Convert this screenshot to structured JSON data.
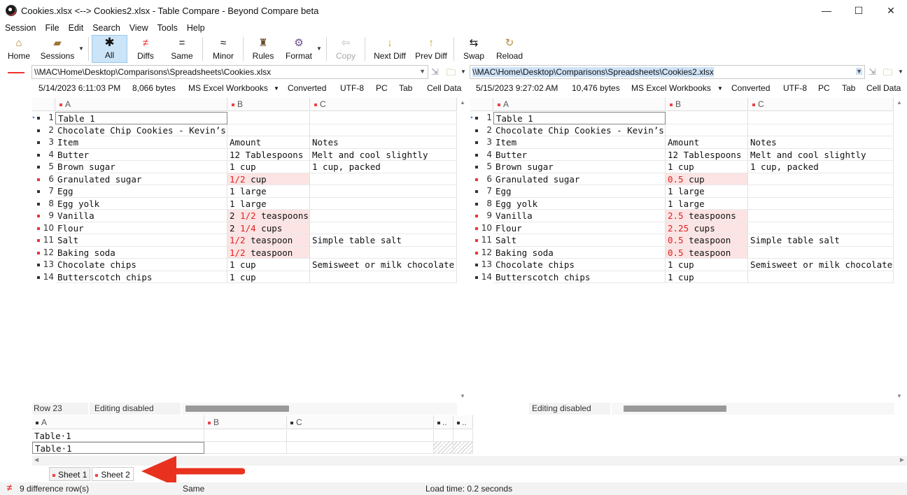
{
  "window": {
    "title": "Cookies.xlsx <--> Cookies2.xlsx - Table Compare - Beyond Compare beta",
    "minimize": "—",
    "maximize": "☐",
    "close": "✕"
  },
  "menu": [
    "Session",
    "File",
    "Edit",
    "Search",
    "View",
    "Tools",
    "Help"
  ],
  "toolbar": {
    "home": "Home",
    "sessions": "Sessions",
    "all": "All",
    "diffs": "Diffs",
    "same": "Same",
    "minor": "Minor",
    "rules": "Rules",
    "format": "Format",
    "copy": "Copy",
    "next_diff": "Next Diff",
    "prev_diff": "Prev Diff",
    "swap": "Swap",
    "reload": "Reload"
  },
  "left": {
    "path": "\\\\MAC\\Home\\Desktop\\Comparisons\\Spreadsheets\\Cookies.xlsx",
    "date": "5/14/2023 6:11:03 PM",
    "size": "8,066 bytes",
    "format": "MS Excel Workbooks",
    "converted": "Converted",
    "encoding": "UTF-8",
    "lineend": "PC",
    "delim": "Tab",
    "celldata": "Cell Data",
    "status_row": "Row 23",
    "status_edit": "Editing disabled"
  },
  "right": {
    "path": "\\\\MAC\\Home\\Desktop\\Comparisons\\Spreadsheets\\Cookies2.xlsx",
    "date": "5/15/2023 9:27:02 AM",
    "size": "10,476 bytes",
    "format": "MS Excel Workbooks",
    "converted": "Converted",
    "encoding": "UTF-8",
    "lineend": "PC",
    "delim": "Tab",
    "celldata": "Cell Data",
    "status_edit": "Editing disabled"
  },
  "columns": [
    "A",
    "B",
    "C"
  ],
  "rows_left": [
    {
      "n": "1",
      "a": "Table 1",
      "b": "",
      "c": ""
    },
    {
      "n": "2",
      "a": "Chocolate Chip Cookies - Kevin’s",
      "b": "",
      "c": ""
    },
    {
      "n": "3",
      "a": "Item",
      "b": "Amount",
      "c": "Notes"
    },
    {
      "n": "4",
      "a": "Butter",
      "b": "12 Tablespoons",
      "c": "Melt and cool slightly"
    },
    {
      "n": "5",
      "a": "Brown sugar",
      "b": "1 cup",
      "c": "1 cup, packed"
    },
    {
      "n": "6",
      "a": "Granulated sugar",
      "b_red": "1/2",
      "b_rest": " cup",
      "c": ""
    },
    {
      "n": "7",
      "a": "Egg",
      "b": "1 large",
      "c": ""
    },
    {
      "n": "8",
      "a": "Egg yolk",
      "b": "1 large",
      "c": ""
    },
    {
      "n": "9",
      "a": "Vanilla",
      "b_pre": "2 ",
      "b_red": "1/2",
      "b_rest": " teaspoons",
      "c": ""
    },
    {
      "n": "10",
      "a": "Flour",
      "b_pre": "2 ",
      "b_red": "1/4",
      "b_rest": " cups",
      "c": ""
    },
    {
      "n": "11",
      "a": "Salt",
      "b_red": "1/2",
      "b_rest": " teaspoon",
      "c": "Simple table salt"
    },
    {
      "n": "12",
      "a": "Baking soda",
      "b_red": "1/2",
      "b_rest": " teaspoon",
      "c": ""
    },
    {
      "n": "13",
      "a": "Chocolate chips",
      "b": "1 cup",
      "c": "Semisweet or milk chocolate"
    },
    {
      "n": "14",
      "a": "Butterscotch chips",
      "b": "1 cup",
      "c": ""
    }
  ],
  "rows_right": [
    {
      "n": "1",
      "a": "Table 1",
      "b": "",
      "c": ""
    },
    {
      "n": "2",
      "a": "Chocolate Chip Cookies - Kevin’s",
      "b": "",
      "c": ""
    },
    {
      "n": "3",
      "a": "Item",
      "b": "Amount",
      "c": "Notes"
    },
    {
      "n": "4",
      "a": "Butter",
      "b": "12 Tablespoons",
      "c": "Melt and cool slightly"
    },
    {
      "n": "5",
      "a": "Brown sugar",
      "b": "1 cup",
      "c": "1 cup, packed"
    },
    {
      "n": "6",
      "a": "Granulated sugar",
      "b_red": "0.5",
      "b_rest": " cup",
      "c": ""
    },
    {
      "n": "7",
      "a": "Egg",
      "b": "1 large",
      "c": ""
    },
    {
      "n": "8",
      "a": "Egg yolk",
      "b": "1 large",
      "c": ""
    },
    {
      "n": "9",
      "a": "Vanilla",
      "b_red": "2.5",
      "b_rest": " teaspoons",
      "c": ""
    },
    {
      "n": "10",
      "a": "Flour",
      "b_red": "2.25",
      "b_rest": " cups",
      "c": ""
    },
    {
      "n": "11",
      "a": "Salt",
      "b_red": "0.5",
      "b_rest": " teaspoon",
      "c": "Simple table salt"
    },
    {
      "n": "12",
      "a": "Baking soda",
      "b_red": "0.5",
      "b_rest": " teaspoon",
      "c": ""
    },
    {
      "n": "13",
      "a": "Chocolate chips",
      "b": "1 cup",
      "c": "Semisweet or milk chocolate"
    },
    {
      "n": "14",
      "a": "Butterscotch chips",
      "b": "1 cup",
      "c": ""
    }
  ],
  "bottom_pane": {
    "cols": [
      "A",
      "B",
      "C",
      "..",
      ".."
    ],
    "line1": "Table·1",
    "line2": "Table·1"
  },
  "tabs": [
    "Sheet 1",
    "Sheet 2"
  ],
  "statusbar": {
    "diff_count": "9 difference row(s)",
    "same": "Same",
    "load_time": "Load time: 0.2 seconds"
  },
  "colors": {
    "diff_bg": "#fce4e4",
    "diff_text": "#e02020",
    "selection": "#cce4f7",
    "arrow": "#e8321f"
  }
}
